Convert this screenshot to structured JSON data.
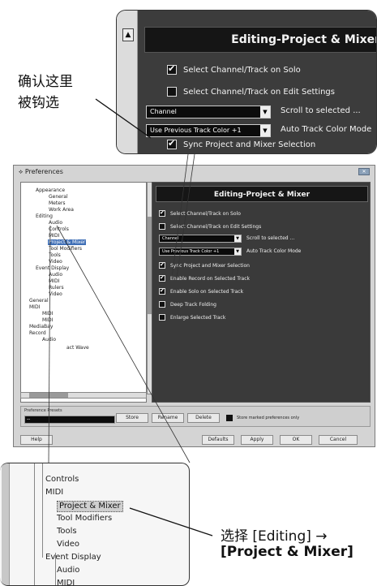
{
  "zoom_top": {
    "title": "Editing-Project & Mixer",
    "items": [
      {
        "label": "Select Channel/Track on Solo",
        "checked": true
      },
      {
        "label": "Select Channel/Track on Edit Settings",
        "checked": false
      }
    ],
    "dropdown1": {
      "value": "Channel",
      "label": "Scroll to selected ..."
    },
    "dropdown2": {
      "value": "Use Previous Track Color +1",
      "label": "Auto Track Color Mode"
    },
    "sync": {
      "label": "Sync Project and Mixer Selection",
      "checked": true
    }
  },
  "callout_top": {
    "line1": "确认这里",
    "line2": "被钩选"
  },
  "window": {
    "title": "Preferences",
    "tree": [
      "Appearance",
      "General",
      "Meters",
      "Work Area",
      "Editing",
      "Audio",
      "Controls",
      "MIDI",
      "Project & Mixer",
      "Tool Modifiers",
      "Tools",
      "Video",
      "Event Display",
      "Audio",
      "MIDI",
      "Rulers",
      "Video",
      "General",
      "MIDI",
      "MIDI",
      "MIDI",
      "MediaBay",
      "Record",
      "Audio",
      "act Wave"
    ],
    "panel": {
      "title": "Editing-Project & Mixer",
      "rows": [
        {
          "label": "Select Channel/Track on Solo",
          "checked": true
        },
        {
          "label": "Select Channel/Track on Edit Settings",
          "checked": false
        }
      ],
      "dropdown1": {
        "value": "Channel",
        "label": "Scroll to selected ..."
      },
      "dropdown2": {
        "value": "Use Previous Track Color +1",
        "label": "Auto Track Color Mode"
      },
      "rows2": [
        {
          "label": "Sync Project and Mixer Selection",
          "checked": true
        },
        {
          "label": "Enable Record on Selected Track",
          "checked": true
        },
        {
          "label": "Enable Solo on Selected Track",
          "checked": true
        },
        {
          "label": "Deep Track Folding",
          "checked": false
        },
        {
          "label": "Enlarge Selected Track",
          "checked": false
        }
      ]
    },
    "presets_label": "Preference Presets",
    "presets_value": "--",
    "buttons": {
      "store": "Store",
      "rename": "Rename",
      "delete": "Delete",
      "store_marked": "Store marked preferences only",
      "help": "Help",
      "defaults": "Defaults",
      "apply": "Apply",
      "ok": "OK",
      "cancel": "Cancel"
    }
  },
  "zoom_bottom": {
    "items": [
      "Controls",
      "MIDI",
      "Project & Mixer",
      "Tool Modifiers",
      "Tools",
      "Video",
      "Event Display",
      "Audio",
      "MIDI"
    ]
  },
  "callout_bottom": {
    "line1": "选择 [Editing] →",
    "line2": "[Project & Mixer]"
  }
}
